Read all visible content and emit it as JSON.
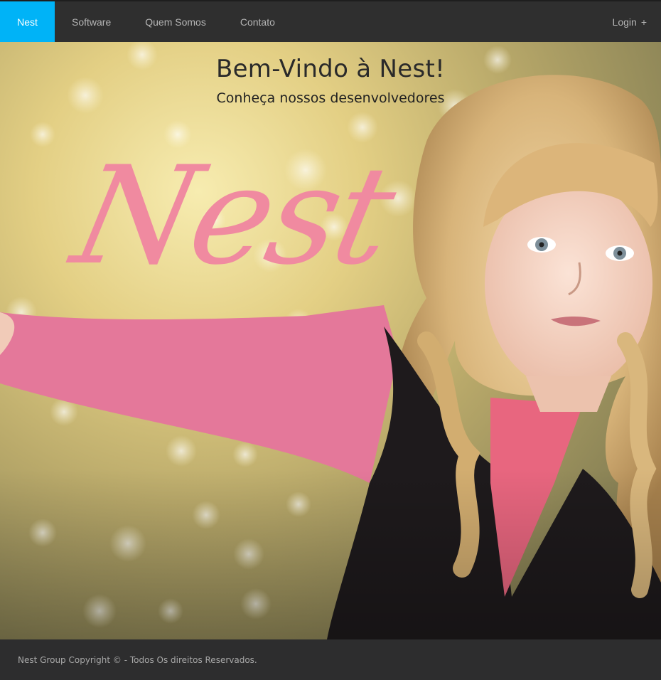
{
  "nav": {
    "brand": "Nest",
    "items": [
      {
        "label": "Software"
      },
      {
        "label": "Quem Somos"
      },
      {
        "label": "Contato"
      }
    ],
    "login": "Login",
    "login_icon": "plus-icon",
    "login_symbol": "+"
  },
  "hero": {
    "title": "Bem-Vindo à  Nest!",
    "subtitle": "Conheça nossos desenvolvedores",
    "logo_text": "Nest",
    "logo_color": "#f08aa0"
  },
  "footer": {
    "text": "Nest Group Copyright © - Todos Os direitos Reservados."
  },
  "colors": {
    "nav_bg": "#2f2f2f",
    "brand_active": "#00b3f7",
    "footer_bg": "#2d2d2e"
  }
}
